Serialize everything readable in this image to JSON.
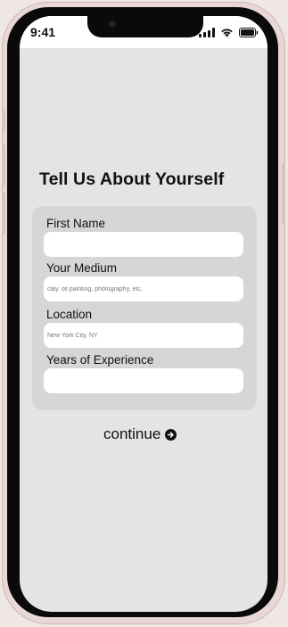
{
  "status_bar": {
    "time": "9:41"
  },
  "form": {
    "title": "Tell Us About Yourself",
    "fields": [
      {
        "label": "First Name",
        "value": "",
        "placeholder": ""
      },
      {
        "label": "Your Medium",
        "value": "",
        "placeholder": "clay, oil painting, photography, etc."
      },
      {
        "label": "Location",
        "value": "",
        "placeholder": "New York City, NY"
      },
      {
        "label": "Years of Experience",
        "value": "",
        "placeholder": ""
      }
    ]
  },
  "actions": {
    "continue_label": "continue",
    "continue_icon": "arrow-right-circle-icon"
  },
  "colors": {
    "screen_bg": "#e4e4e4",
    "card_bg": "#d6d6d6",
    "input_bg": "#ffffff",
    "text": "#111111"
  }
}
